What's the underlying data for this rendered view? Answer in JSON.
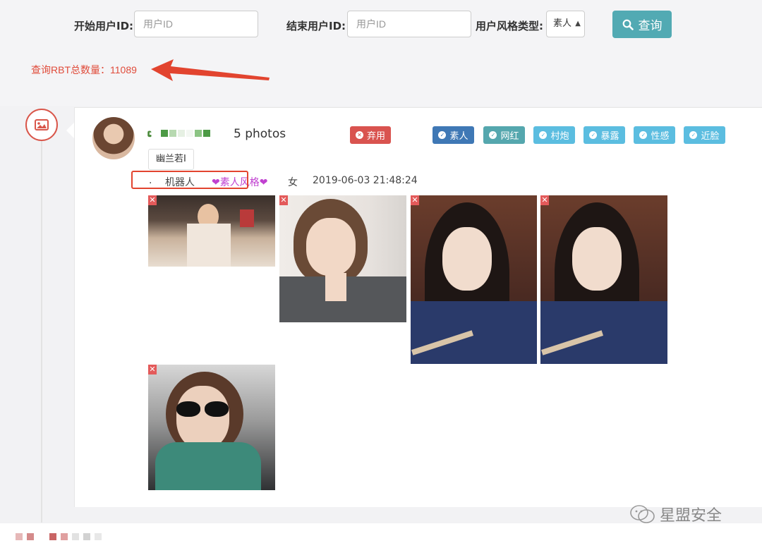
{
  "search": {
    "start_label": "开始用户ID:",
    "start_placeholder": "用户ID",
    "end_label": "结束用户ID:",
    "end_placeholder": "用户ID",
    "style_label": "用户风格类型:",
    "style_value": "素人",
    "query_label": "查询"
  },
  "result": {
    "total_text": "查询RBT总数量：11089"
  },
  "card": {
    "username_prefix": "ເ",
    "photos_count": "5 photos",
    "discard_label": "弃用",
    "tags": [
      "素人",
      "网红",
      "村炮",
      "暴露",
      "性感",
      "近脸"
    ],
    "tag_colors": [
      "#3f78b5",
      "#55a7ae",
      "#5bbde0",
      "#5bbde0",
      "#5bbde0",
      "#5bbde0"
    ],
    "nickname": "幽兰若I",
    "meta_dot": ".",
    "meta_robot": "机器人",
    "meta_style": "❤素人风格❤",
    "meta_gender": "女",
    "meta_date": "2019-06-03 21:48:24",
    "photo_remove_icon": "close-icon"
  },
  "watermark": {
    "text": "星盟安全"
  },
  "colors": {
    "accent_query": "#52aab3",
    "total_red": "#e04b3a",
    "discard_red": "#d9534f",
    "highlight_box": "#e2442f",
    "style_purple": "#c040d0"
  }
}
